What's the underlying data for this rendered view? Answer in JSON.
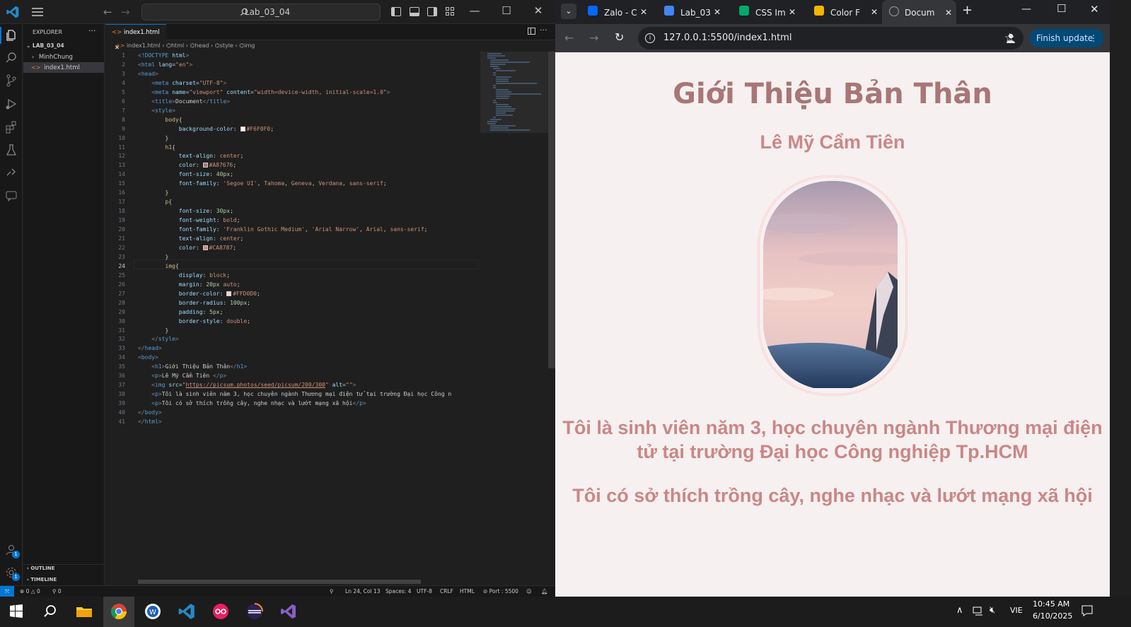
{
  "vscode": {
    "search_label": "Lab_03_04",
    "explorer_title": "EXPLORER",
    "folder": "LAB_03_04",
    "tree": [
      "MinhChung",
      "index1.html"
    ],
    "tab": "index1.html",
    "breadcrumb": [
      "index1.html",
      "html",
      "head",
      "style",
      "img"
    ],
    "outline": "OUTLINE",
    "timeline": "TIMELINE",
    "status": {
      "errors": "0",
      "warnings": "0",
      "ports": "0",
      "position": "Ln 24, Col 13",
      "spaces": "Spaces: 4",
      "encoding": "UTF-8",
      "eol": "CRLF",
      "language": "HTML",
      "port": "Port : 5500"
    },
    "code_lines": [
      "<!DOCTYPE html>",
      "<html lang=\"en\">",
      "<head>",
      "    <meta charset=\"UTF-8\">",
      "    <meta name=\"viewport\" content=\"width=device-width, initial-scale=1.0\">",
      "    <title>Document</title>",
      "    <style>",
      "        body{",
      "            background-color: #F6F0F0;",
      "        }",
      "        h1{",
      "            text-align: center;",
      "            color: #A87676;",
      "            font-size: 40px;",
      "            font-family: 'Segoe UI', Tahoma, Geneva, Verdana, sans-serif;",
      "        }",
      "        p{",
      "            font-size: 30px;",
      "            font-weight: bold;",
      "            font-family: 'Franklin Gothic Medium', 'Arial Narrow', Arial, sans-serif;",
      "            text-align: center;",
      "            color: #CA8787;",
      "        }",
      "        img{",
      "            display: block;",
      "            margin: 20px auto;",
      "            border-color: #FFD0D0;",
      "            border-radius: 100px;",
      "            padding: 5px;",
      "            border-style: double;",
      "        }",
      "    </style>",
      "</head>",
      "<body>",
      "    <h1>Giới Thiệu Bản Thân</h1>",
      "    <p>Lê Mỹ Cẩm Tiên </p>",
      "    <img src=\"https://picsum.photos/seed/picsum/200/300\" alt=\"\">",
      "    <p>Tôi là sinh viên năm 3, học chuyên ngành Thương mại điện tử tại trường Đại học Công n",
      "    <p>Tôi có sở thích trồng cây, nghe nhạc và lướt mạng xã hội</p>",
      "</body>",
      "</html>"
    ]
  },
  "browser": {
    "tabs": [
      "Zalo - C",
      "Lab_03",
      "CSS Im",
      "Color F",
      "Docum"
    ],
    "url": "127.0.0.1:5500/index1.html",
    "finish_update": "Finish update",
    "page": {
      "h1": "Giới Thiệu Bản Thân",
      "name": "Lê Mỹ Cẩm Tiên",
      "para1": "Tôi là sinh viên năm 3, học chuyên ngành Thương mại điện tử tại trường Đại học Công nghiệp Tp.HCM",
      "para2": "Tôi có sở thích trồng cây, nghe nhạc và lướt mạng xã hội"
    }
  },
  "taskbar": {
    "lang": "VIE",
    "time": "10:45 AM",
    "date": "6/10/2025"
  },
  "colors": {
    "h1": "#A87676",
    "p": "#CA8787",
    "body_bg": "#F6F0F0",
    "img_border": "#FFD0D0",
    "vscode_accent": "#0078d4"
  }
}
